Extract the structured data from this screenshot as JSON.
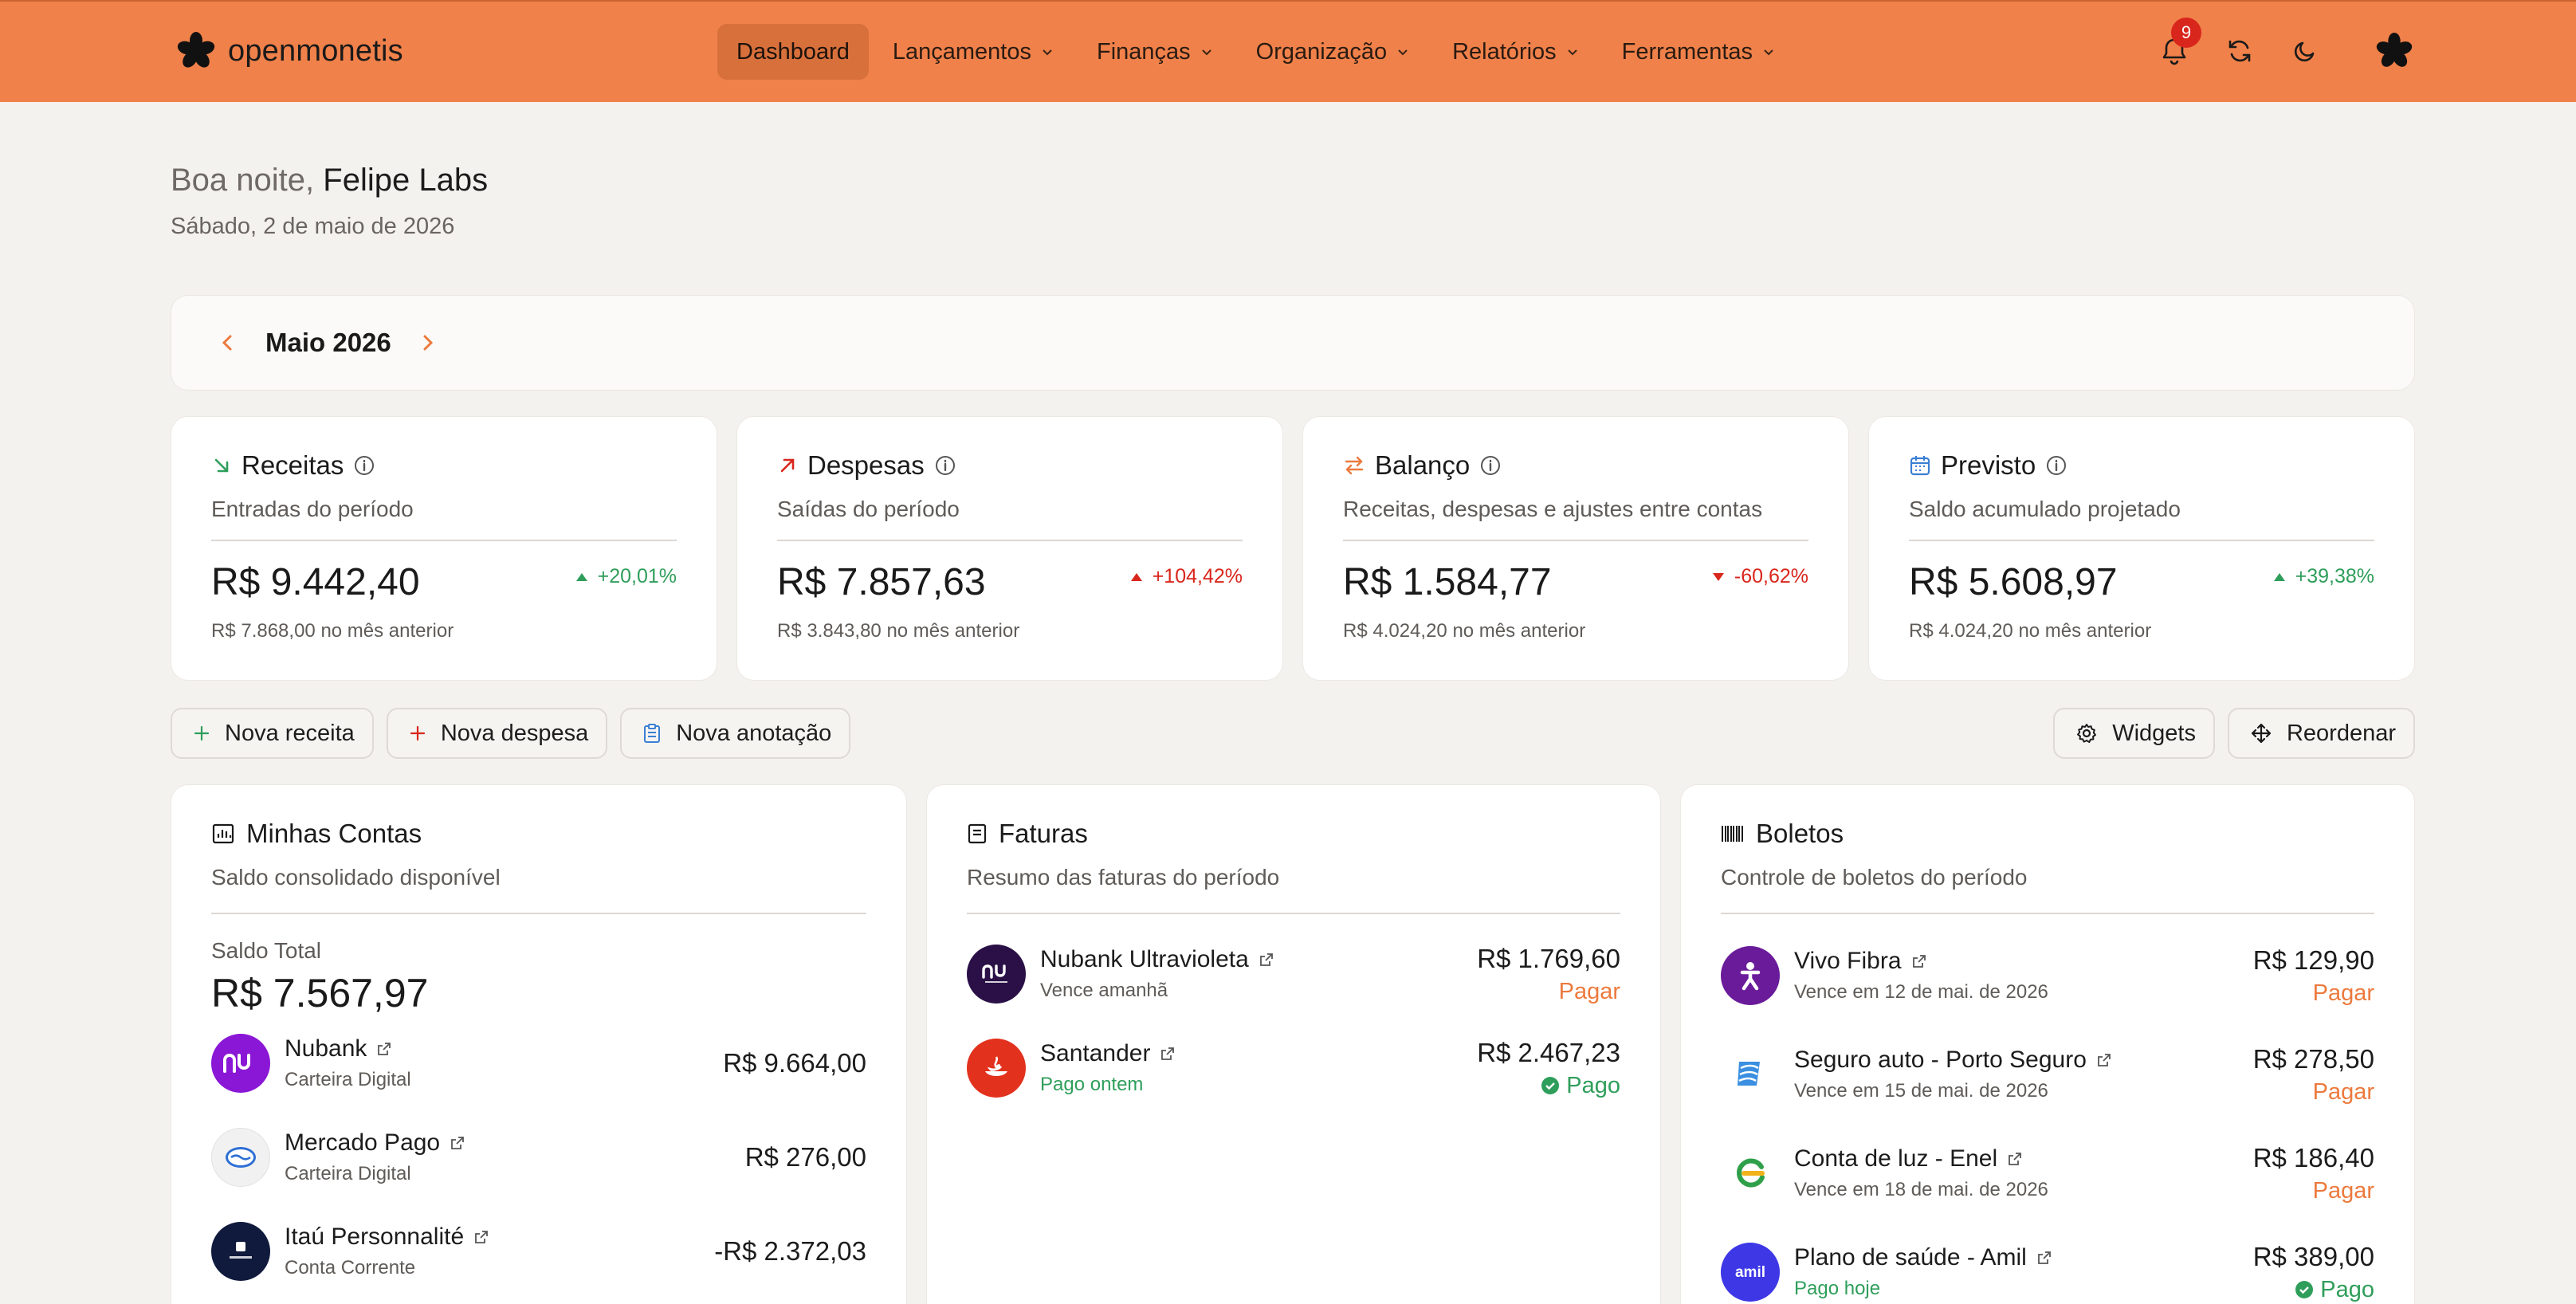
{
  "brand": {
    "name": "openmonetis",
    "accent": "#f0814a"
  },
  "nav": {
    "items": [
      {
        "label": "Dashboard",
        "active": true
      },
      {
        "label": "Lançamentos"
      },
      {
        "label": "Finanças"
      },
      {
        "label": "Organização"
      },
      {
        "label": "Relatórios"
      },
      {
        "label": "Ferramentas"
      }
    ],
    "notifications_count": "9",
    "icons": [
      "bell-icon",
      "sync-icon",
      "moon-icon",
      "user-avatar"
    ]
  },
  "greeting": {
    "prefix": "Boa noite,",
    "name": "Felipe Labs",
    "date": "Sábado, 2 de maio de 2026"
  },
  "period": {
    "label": "Maio 2026"
  },
  "stats": [
    {
      "title": "Receitas",
      "subtitle": "Entradas do período",
      "value": "R$ 9.442,40",
      "delta": "+20,01%",
      "trend": "up",
      "previous": "R$ 7.868,00 no mês anterior",
      "icon": "arrow-down-right-icon",
      "color": "#2f9e5b"
    },
    {
      "title": "Despesas",
      "subtitle": "Saídas do período",
      "value": "R$ 7.857,63",
      "delta": "+104,42%",
      "trend": "up-bad",
      "previous": "R$ 3.843,80 no mês anterior",
      "icon": "arrow-up-right-icon",
      "color": "#d9261c"
    },
    {
      "title": "Balanço",
      "subtitle": "Receitas, despesas e ajustes entre contas",
      "value": "R$ 1.584,77",
      "delta": "-60,62%",
      "trend": "down",
      "previous": "R$ 4.024,20 no mês anterior",
      "icon": "swap-icon",
      "color": "#ec7a3d"
    },
    {
      "title": "Previsto",
      "subtitle": "Saldo acumulado projetado",
      "value": "R$ 5.608,97",
      "delta": "+39,38%",
      "trend": "up",
      "previous": "R$ 4.024,20 no mês anterior",
      "icon": "calendar-icon",
      "color": "#3b7fd4"
    }
  ],
  "actions": {
    "new_income": "Nova receita",
    "new_expense": "Nova despesa",
    "new_note": "Nova anotação",
    "widgets": "Widgets",
    "reorder": "Reordenar"
  },
  "accounts": {
    "title": "Minhas Contas",
    "subtitle": "Saldo consolidado disponível",
    "total_label": "Saldo Total",
    "total_value": "R$ 7.567,97",
    "items": [
      {
        "name": "Nubank",
        "type": "Carteira Digital",
        "balance": "R$ 9.664,00"
      },
      {
        "name": "Mercado Pago",
        "type": "Carteira Digital",
        "balance": "R$ 276,00"
      },
      {
        "name": "Itaú Personnalité",
        "type": "Conta Corrente",
        "balance": "-R$ 2.372,03"
      }
    ]
  },
  "invoices": {
    "title": "Faturas",
    "subtitle": "Resumo das faturas do período",
    "items": [
      {
        "name": "Nubank Ultravioleta",
        "status_text": "Vence amanhã",
        "amount": "R$ 1.769,60",
        "action": "Pagar"
      },
      {
        "name": "Santander",
        "status_text": "Pago ontem",
        "amount": "R$ 2.467,23",
        "action": "Pago"
      }
    ]
  },
  "bills": {
    "title": "Boletos",
    "subtitle": "Controle de boletos do período",
    "items": [
      {
        "name": "Vivo Fibra",
        "due": "Vence em 12 de mai. de 2026",
        "amount": "R$ 129,90",
        "action": "Pagar"
      },
      {
        "name": "Seguro auto - Porto Seguro",
        "due": "Vence em 15 de mai. de 2026",
        "amount": "R$ 278,50",
        "action": "Pagar"
      },
      {
        "name": "Conta de luz - Enel",
        "due": "Vence em 18 de mai. de 2026",
        "amount": "R$ 186,40",
        "action": "Pagar"
      },
      {
        "name": "Plano de saúde - Amil",
        "due": "Pago hoje",
        "amount": "R$ 389,00",
        "action": "Pago"
      }
    ]
  }
}
